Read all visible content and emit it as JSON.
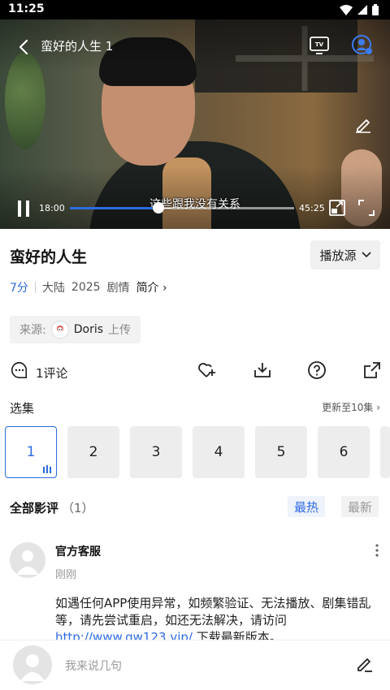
{
  "status_bar": {
    "time": "11:25"
  },
  "player": {
    "title": "蛮好的人生 1",
    "subtitle": "这些跟我没有关系",
    "current_time": "18:00",
    "total_time": "45:25",
    "progress": 0.396
  },
  "info": {
    "title": "蛮好的人生",
    "source_button": "播放源",
    "score": "7分",
    "region": "大陆",
    "year": "2025",
    "genre": "剧情",
    "intro": "简介",
    "uploader_label": "来源:",
    "uploader_name": "Doris",
    "uploader_suffix": "上传"
  },
  "actions": {
    "comment_count": "1评论"
  },
  "episodes": {
    "header": "选集",
    "update_text": "更新至10集",
    "items": [
      "1",
      "2",
      "3",
      "4",
      "5",
      "6"
    ],
    "active_index": 0
  },
  "comments": {
    "header": "全部影评",
    "count": "（1）",
    "sort_hot": "最热",
    "sort_new": "最新",
    "items": [
      {
        "name": "官方客服",
        "time": "刚刚",
        "text_1": "如遇任何APP使用异常，如频繁验证、无法播放、剧集错乱等，请先尝试重启，如还无法解决，请访问",
        "link": "http://www.qw123.vip/",
        "text_2": " 下载最新版本。"
      }
    ]
  },
  "bottom": {
    "placeholder": "我来说几句"
  },
  "colors": {
    "accent": "#2d6be0"
  }
}
